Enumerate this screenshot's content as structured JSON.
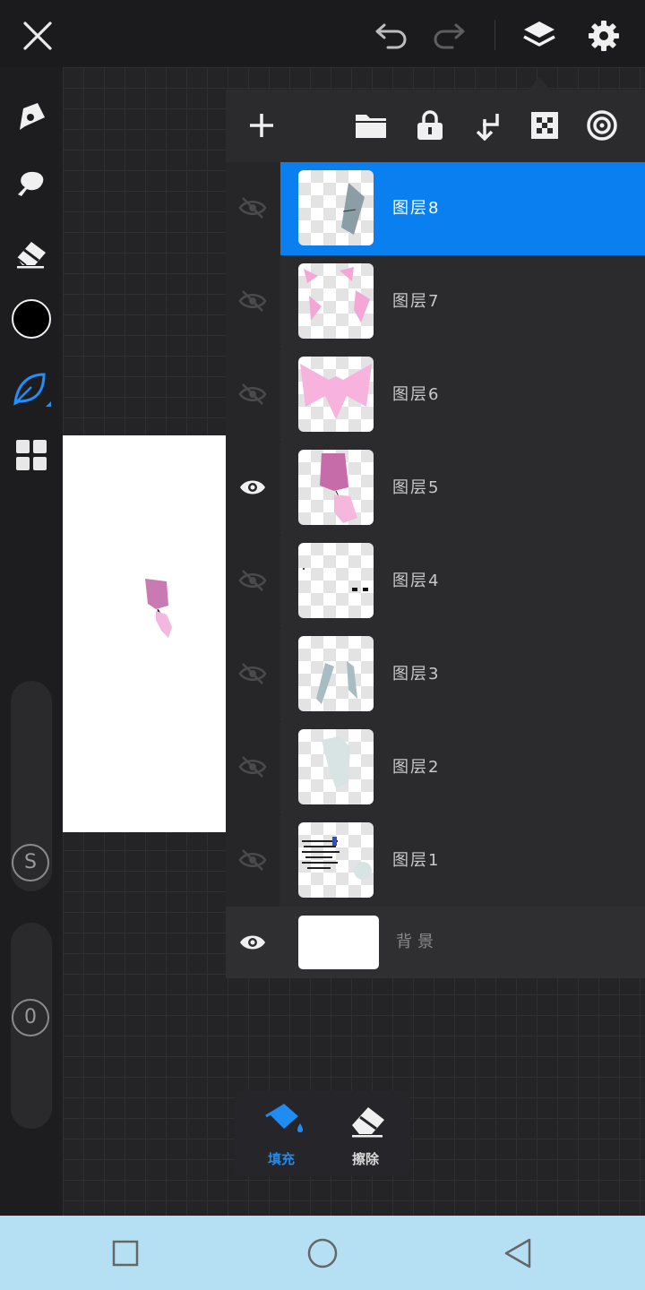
{
  "toolbar": {
    "close": "close-icon",
    "undo": "undo-icon",
    "redo": "redo-icon",
    "layers": "layers-icon",
    "settings": "gear-icon"
  },
  "tools": [
    "pen-icon",
    "smudge-icon",
    "eraser-icon",
    "color-swatch",
    "brush-leaf-icon",
    "gallery-grid-icon"
  ],
  "sliders": {
    "size_label": "S",
    "opacity_label": "0"
  },
  "layer_panel": {
    "actions": [
      "add-layer-icon",
      "folder-icon",
      "lock-icon",
      "merge-down-icon",
      "transparency-icon",
      "target-icon"
    ],
    "layers": [
      {
        "name": "图层8",
        "visible": false,
        "selected": true
      },
      {
        "name": "图层7",
        "visible": false,
        "selected": false
      },
      {
        "name": "图层6",
        "visible": false,
        "selected": false
      },
      {
        "name": "图层5",
        "visible": true,
        "selected": false
      },
      {
        "name": "图层4",
        "visible": false,
        "selected": false
      },
      {
        "name": "图层3",
        "visible": false,
        "selected": false
      },
      {
        "name": "图层2",
        "visible": false,
        "selected": false
      },
      {
        "name": "图层1",
        "visible": false,
        "selected": false
      }
    ],
    "background": {
      "name": "背景",
      "visible": true
    }
  },
  "popup": {
    "fill_label": "填充",
    "erase_label": "擦除"
  },
  "colors": {
    "accent": "#0a7ff0",
    "current_color": "#000000"
  },
  "navbar": [
    "recent-apps-icon",
    "home-icon",
    "back-icon"
  ]
}
